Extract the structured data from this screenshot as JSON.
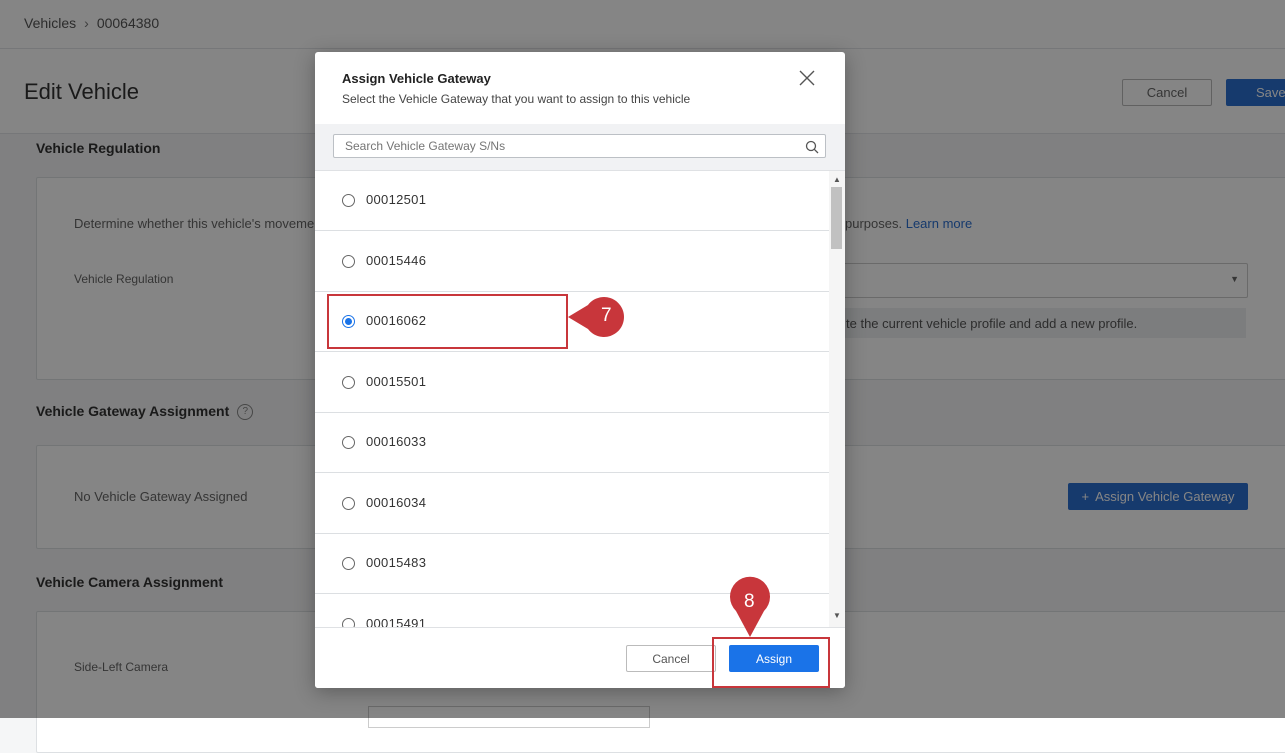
{
  "breadcrumb": {
    "root": "Vehicles",
    "separator": "›",
    "current": "00064380"
  },
  "page": {
    "title": "Edit Vehicle",
    "cancel_label": "Cancel",
    "save_label": "Save"
  },
  "regulation": {
    "section_title": "Vehicle Regulation",
    "description_left": "Determine whether this vehicle's moveme",
    "description_right": "purposes.",
    "learn_more": "Learn more",
    "field_label": "Vehicle Regulation",
    "note_text": "te the current vehicle profile and add a new profile."
  },
  "gateway_assignment": {
    "section_title": "Vehicle Gateway Assignment",
    "help_icon": "?",
    "empty_text": "No Vehicle Gateway Assigned",
    "assign_button": "Assign Vehicle Gateway",
    "assign_button_icon": "+"
  },
  "camera_assignment": {
    "section_title": "Vehicle Camera Assignment",
    "field_label": "Side-Left Camera"
  },
  "modal": {
    "title": "Assign Vehicle Gateway",
    "subtitle": "Select the Vehicle Gateway that you want to assign to this vehicle",
    "search_placeholder": "Search Vehicle Gateway S/Ns",
    "items": [
      {
        "label": "00012501",
        "selected": false
      },
      {
        "label": "00015446",
        "selected": false
      },
      {
        "label": "00016062",
        "selected": true
      },
      {
        "label": "00015501",
        "selected": false
      },
      {
        "label": "00016033",
        "selected": false
      },
      {
        "label": "00016034",
        "selected": false
      },
      {
        "label": "00015483",
        "selected": false
      },
      {
        "label": "00015491",
        "selected": false
      }
    ],
    "cancel_label": "Cancel",
    "assign_label": "Assign"
  },
  "annotations": {
    "step_7": "7",
    "step_8": "8",
    "color": "#c8363b"
  },
  "colors": {
    "accent": "#1a73e8",
    "annotation": "#c8363b"
  }
}
